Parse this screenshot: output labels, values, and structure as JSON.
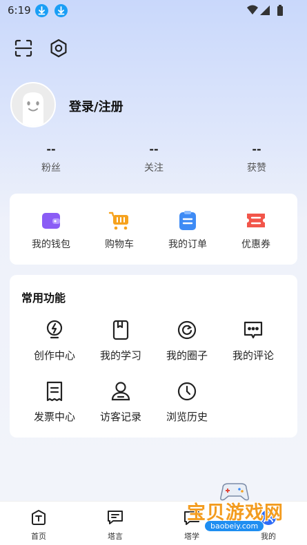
{
  "status_bar": {
    "time": "6:19"
  },
  "toolbar": {
    "scan_icon": "scan-icon",
    "settings_icon": "hexagon-settings-icon"
  },
  "profile": {
    "login_label": "登录/注册"
  },
  "stats": [
    {
      "value": "--",
      "label": "粉丝"
    },
    {
      "value": "--",
      "label": "关注"
    },
    {
      "value": "--",
      "label": "获赞"
    }
  ],
  "quick_actions": [
    {
      "label": "我的钱包",
      "icon": "wallet-icon",
      "color": "#8a5cf5"
    },
    {
      "label": "购物车",
      "icon": "cart-icon",
      "color": "#f6a21d"
    },
    {
      "label": "我的订单",
      "icon": "order-icon",
      "color": "#3e8bf5"
    },
    {
      "label": "优惠券",
      "icon": "coupon-icon",
      "color": "#f2554a"
    }
  ],
  "common_functions": {
    "title": "常用功能",
    "items": [
      {
        "label": "创作中心",
        "icon": "bulb-icon"
      },
      {
        "label": "我的学习",
        "icon": "book-icon"
      },
      {
        "label": "我的圈子",
        "icon": "circle-icon"
      },
      {
        "label": "我的评论",
        "icon": "comment-icon"
      },
      {
        "label": "发票中心",
        "icon": "invoice-icon"
      },
      {
        "label": "访客记录",
        "icon": "visitor-icon"
      },
      {
        "label": "浏览历史",
        "icon": "clock-icon"
      }
    ]
  },
  "tabbar": [
    {
      "label": "首页",
      "icon": "home-icon"
    },
    {
      "label": "塔言",
      "icon": "chat-icon"
    },
    {
      "label": "塔学",
      "icon": "study-icon"
    },
    {
      "label": "我的",
      "icon": "me-icon"
    }
  ],
  "watermark": {
    "text": "宝贝游戏网",
    "url": "baobeiy.com"
  }
}
